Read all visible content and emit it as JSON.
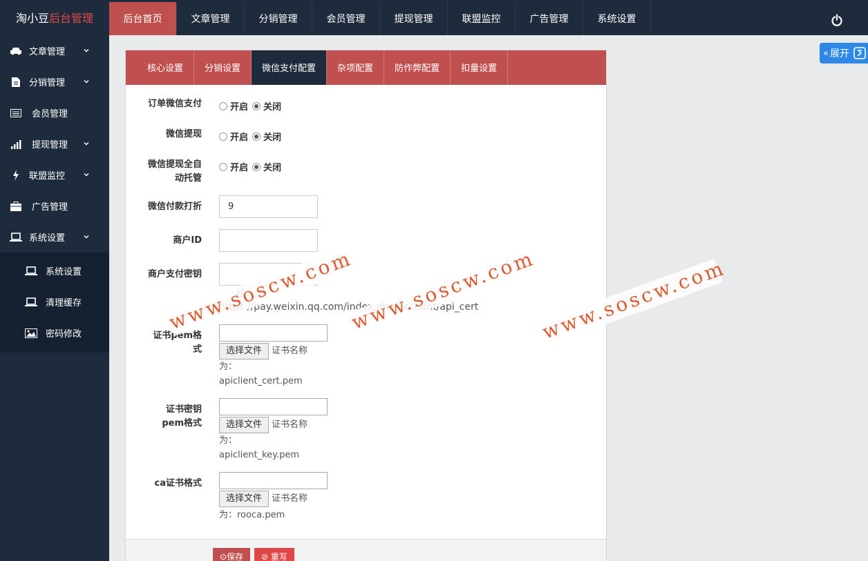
{
  "app": {
    "logo_prefix": "淘小豆",
    "logo_accent": "后台管理"
  },
  "nav": [
    "后台首页",
    "文章管理",
    "分销管理",
    "会员管理",
    "提现管理",
    "联盟监控",
    "广告管理",
    "系统设置"
  ],
  "sidebar": {
    "items": [
      "文章管理",
      "分销管理",
      "会员管理",
      "提现管理",
      "联盟监控",
      "广告管理",
      "系统设置"
    ],
    "subitems": [
      "系统设置",
      "清理缓存",
      "密码修改"
    ]
  },
  "expand_label": "展开",
  "tabs": [
    "核心设置",
    "分销设置",
    "微信支付配置",
    "杂项配置",
    "防作弊配置",
    "扣量设置"
  ],
  "form": {
    "order_wxpay_label": "订单微信支付",
    "wx_withdraw_label": "微信提现",
    "wx_auto_label_1": "微信提现全自",
    "wx_auto_label_2": "动托管",
    "open_label": "开启",
    "close_label": "关闭",
    "discount_label": "微信付款打折",
    "discount_value": "9",
    "merchant_id_label": "商户ID",
    "merchant_key_label": "商户支付密钥",
    "url_prefix": "址：",
    "url_text": "https://pay.weixin.qq.com/index.php/account/api_cert",
    "cert_label_1": "证书pem格",
    "cert_label_2": "式",
    "certkey_label_1": "证书密钥",
    "certkey_label_2": "pem格式",
    "ca_label": "ca证书格式",
    "choose_file": "选择文件",
    "cert_name_prefix": "证书名称",
    "cert_name_for": "为：",
    "cert_file": "apiclient_cert.pem",
    "key_file": "apiclient_key.pem",
    "ca_file": "rooca.pem",
    "ca_hint": "为：rooca.pem"
  },
  "buttons": {
    "save": "保存",
    "reset": "重写"
  },
  "watermark": "www.soscw.com",
  "colors": {
    "topbar": "#1e2b3c",
    "accent": "#c0504f",
    "expand": "#2d88e8"
  }
}
